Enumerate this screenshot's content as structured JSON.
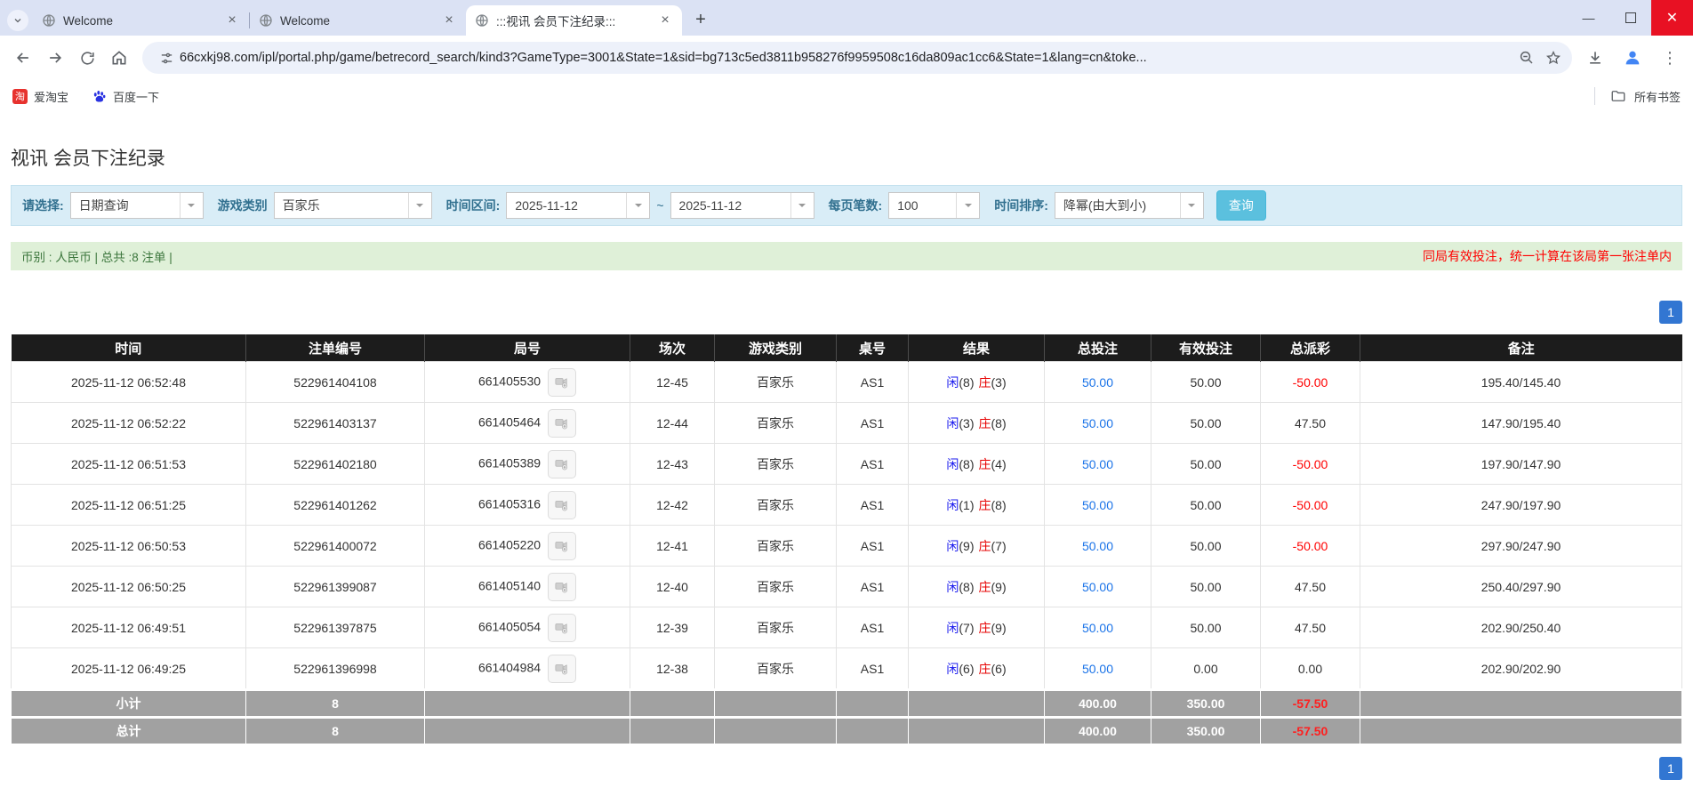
{
  "colors": {
    "accent_blue": "#3276d2",
    "table_header_bg": "#1c1c1c",
    "filter_bar_bg": "#d9edf7",
    "filter_label": "#31708f",
    "search_button_bg": "#5bc0de",
    "info_bar_bg": "#dff0d8",
    "info_text": "#3c763d",
    "notice_red": "#ff0000",
    "player_blue": "#1a1aee",
    "banker_red": "#e60000",
    "link_blue": "#1a73e8",
    "subtotal_bg": "#a1a1a1"
  },
  "browser": {
    "tabs": [
      {
        "title": "Welcome"
      },
      {
        "title": "Welcome"
      },
      {
        "title": ":::视讯 会员下注纪录:::"
      }
    ],
    "url": "66cxkj98.com/ipl/portal.php/game/betrecord_search/kind3?GameType=3001&State=1&sid=bg713c5ed3811b958276f9959508c16da809ac1cc6&State=1&lang=cn&toke...",
    "bookmarks": {
      "taobao_glyph": "淘",
      "taobao": "爱淘宝",
      "baidu": "百度一下",
      "all": "所有书签"
    }
  },
  "page": {
    "title": "视讯 会员下注纪录",
    "filter": {
      "select_label": "请选择:",
      "select_value": "日期查询",
      "game_label": "游戏类别",
      "game_value": "百家乐",
      "range_label": "时间区间:",
      "date_from": "2025-11-12",
      "tilde": "~",
      "date_to": "2025-11-12",
      "per_page_label": "每页笔数:",
      "per_page_value": "100",
      "sort_label": "时间排序:",
      "sort_value": "降幂(由大到小)",
      "search_button": "查询"
    },
    "info_bar": {
      "left": "币别 : 人民币 | 总共 :8 注单 |",
      "right": "同局有效投注，统一计算在该局第一张注单内"
    },
    "pagination": {
      "page": "1"
    },
    "table": {
      "headers": [
        "时间",
        "注单编号",
        "局号",
        "场次",
        "游戏类别",
        "桌号",
        "结果",
        "总投注",
        "有效投注",
        "总派彩",
        "备注"
      ],
      "rows": [
        {
          "time": "2025-11-12 06:52:48",
          "bet_id": "522961404108",
          "round_id": "661405530",
          "session": "12-45",
          "game": "百家乐",
          "table_no": "AS1",
          "player": "闲",
          "player_score": "(8)",
          "banker": "庄",
          "banker_score": "(3)",
          "total_bet": "50.00",
          "valid_bet": "50.00",
          "payout": "-50.00",
          "remark": "195.40/145.40"
        },
        {
          "time": "2025-11-12 06:52:22",
          "bet_id": "522961403137",
          "round_id": "661405464",
          "session": "12-44",
          "game": "百家乐",
          "table_no": "AS1",
          "player": "闲",
          "player_score": "(3)",
          "banker": "庄",
          "banker_score": "(8)",
          "total_bet": "50.00",
          "valid_bet": "50.00",
          "payout": "47.50",
          "remark": "147.90/195.40"
        },
        {
          "time": "2025-11-12 06:51:53",
          "bet_id": "522961402180",
          "round_id": "661405389",
          "session": "12-43",
          "game": "百家乐",
          "table_no": "AS1",
          "player": "闲",
          "player_score": "(8)",
          "banker": "庄",
          "banker_score": "(4)",
          "total_bet": "50.00",
          "valid_bet": "50.00",
          "payout": "-50.00",
          "remark": "197.90/147.90"
        },
        {
          "time": "2025-11-12 06:51:25",
          "bet_id": "522961401262",
          "round_id": "661405316",
          "session": "12-42",
          "game": "百家乐",
          "table_no": "AS1",
          "player": "闲",
          "player_score": "(1)",
          "banker": "庄",
          "banker_score": "(8)",
          "total_bet": "50.00",
          "valid_bet": "50.00",
          "payout": "-50.00",
          "remark": "247.90/197.90"
        },
        {
          "time": "2025-11-12 06:50:53",
          "bet_id": "522961400072",
          "round_id": "661405220",
          "session": "12-41",
          "game": "百家乐",
          "table_no": "AS1",
          "player": "闲",
          "player_score": "(9)",
          "banker": "庄",
          "banker_score": "(7)",
          "total_bet": "50.00",
          "valid_bet": "50.00",
          "payout": "-50.00",
          "remark": "297.90/247.90"
        },
        {
          "time": "2025-11-12 06:50:25",
          "bet_id": "522961399087",
          "round_id": "661405140",
          "session": "12-40",
          "game": "百家乐",
          "table_no": "AS1",
          "player": "闲",
          "player_score": "(8)",
          "banker": "庄",
          "banker_score": "(9)",
          "total_bet": "50.00",
          "valid_bet": "50.00",
          "payout": "47.50",
          "remark": "250.40/297.90"
        },
        {
          "time": "2025-11-12 06:49:51",
          "bet_id": "522961397875",
          "round_id": "661405054",
          "session": "12-39",
          "game": "百家乐",
          "table_no": "AS1",
          "player": "闲",
          "player_score": "(7)",
          "banker": "庄",
          "banker_score": "(9)",
          "total_bet": "50.00",
          "valid_bet": "50.00",
          "payout": "47.50",
          "remark": "202.90/250.40"
        },
        {
          "time": "2025-11-12 06:49:25",
          "bet_id": "522961396998",
          "round_id": "661404984",
          "session": "12-38",
          "game": "百家乐",
          "table_no": "AS1",
          "player": "闲",
          "player_score": "(6)",
          "banker": "庄",
          "banker_score": "(6)",
          "total_bet": "50.00",
          "valid_bet": "0.00",
          "payout": "0.00",
          "remark": "202.90/202.90"
        }
      ],
      "subtotal": {
        "label": "小计",
        "count": "8",
        "total_bet": "400.00",
        "valid_bet": "350.00",
        "payout": "-57.50"
      },
      "total": {
        "label": "总计",
        "count": "8",
        "total_bet": "400.00",
        "valid_bet": "350.00",
        "payout": "-57.50"
      }
    }
  }
}
